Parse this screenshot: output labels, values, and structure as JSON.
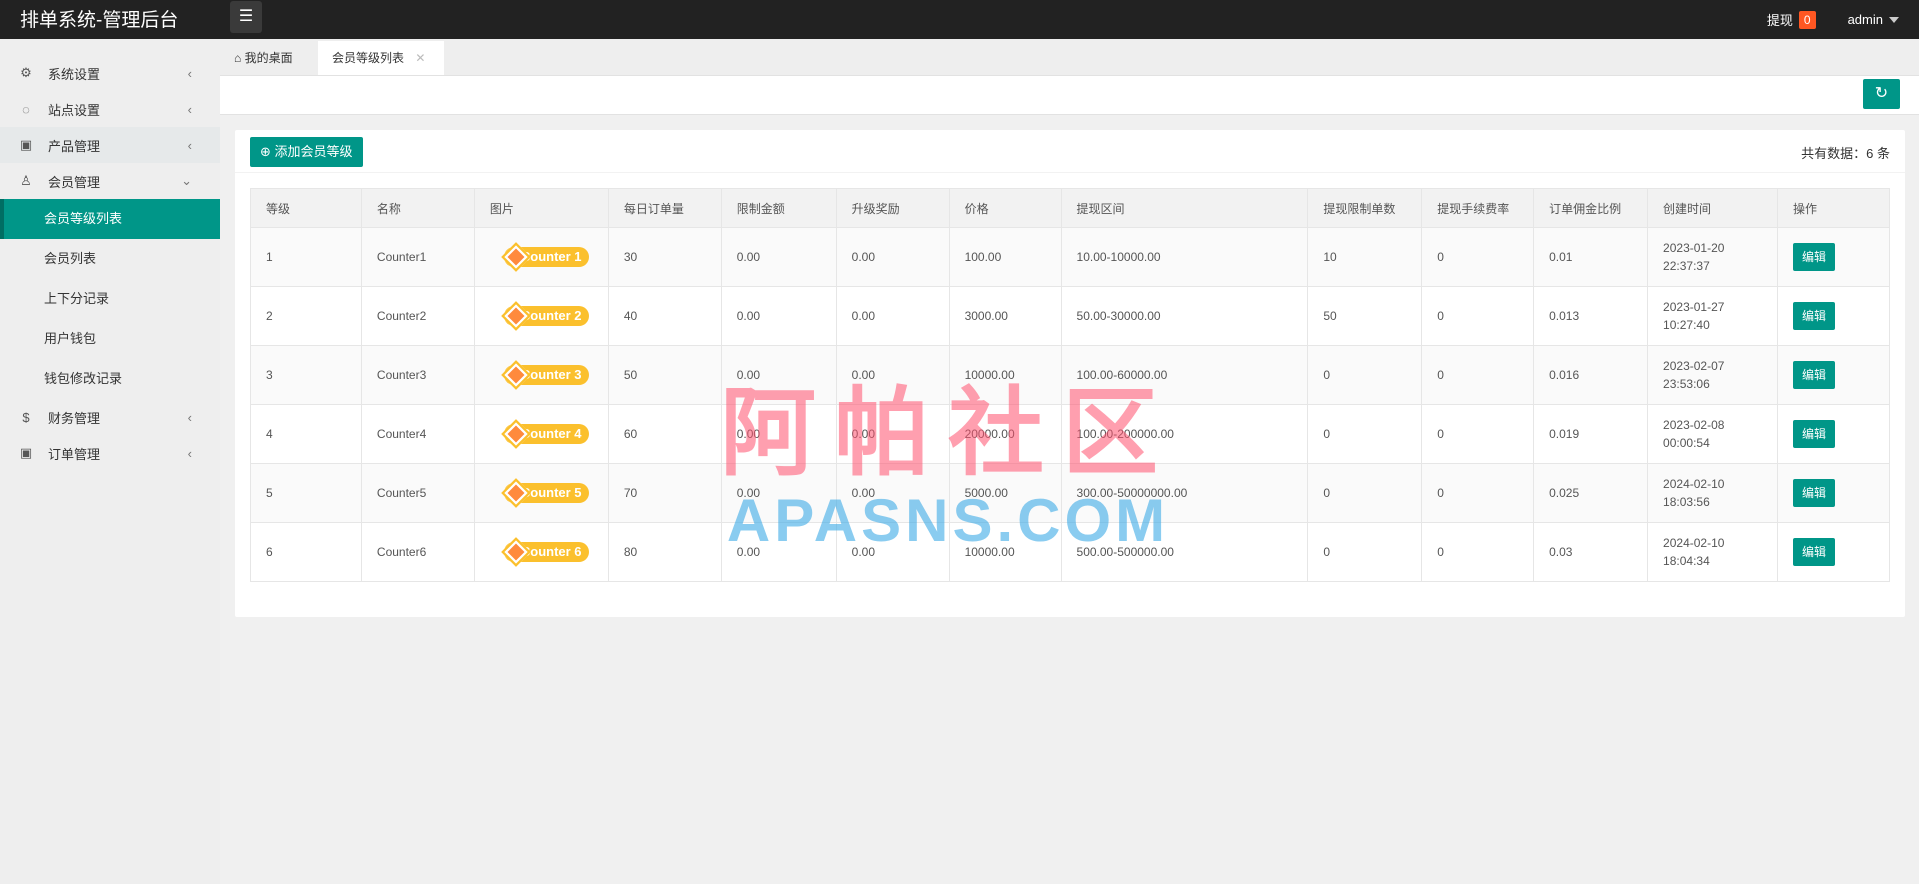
{
  "header": {
    "title": "排单系统-管理后台",
    "withdraw_label": "提现",
    "withdraw_count": "0",
    "user": "admin"
  },
  "sidebar": {
    "items": [
      {
        "label": "系统设置",
        "icon": "gear-icon"
      },
      {
        "label": "站点设置",
        "icon": "site-icon"
      },
      {
        "label": "产品管理",
        "icon": "box-icon"
      },
      {
        "label": "会员管理",
        "icon": "user-icon"
      },
      {
        "label": "财务管理",
        "icon": "dollar-icon"
      },
      {
        "label": "订单管理",
        "icon": "box-icon"
      }
    ],
    "sub_items": [
      "会员等级列表",
      "会员列表",
      "上下分记录",
      "用户钱包",
      "钱包修改记录"
    ]
  },
  "tabs": {
    "home": "我的桌面",
    "current": "会员等级列表"
  },
  "card": {
    "add_label": "添加会员等级",
    "total": "共有数据：6 条"
  },
  "table": {
    "headers": [
      "等级",
      "名称",
      "图片",
      "每日订单量",
      "限制金额",
      "升级奖励",
      "价格",
      "提现区间",
      "提现限制单数",
      "提现手续费率",
      "订单佣金比例",
      "创建时间",
      "操作"
    ],
    "rows": [
      [
        "1",
        "Counter1",
        "Counter 1",
        "30",
        "0.00",
        "0.00",
        "100.00",
        "10.00-10000.00",
        "10",
        "0",
        "0.01",
        "2023-01-20 22:37:37",
        "编辑"
      ],
      [
        "2",
        "Counter2",
        "Counter 2",
        "40",
        "0.00",
        "0.00",
        "3000.00",
        "50.00-30000.00",
        "50",
        "0",
        "0.013",
        "2023-01-27 10:27:40",
        "编辑"
      ],
      [
        "3",
        "Counter3",
        "Counter 3",
        "50",
        "0.00",
        "0.00",
        "10000.00",
        "100.00-60000.00",
        "0",
        "0",
        "0.016",
        "2023-02-07 23:53:06",
        "编辑"
      ],
      [
        "4",
        "Counter4",
        "Counter 4",
        "60",
        "0.00",
        "0.00",
        "20000.00",
        "100.00-200000.00",
        "0",
        "0",
        "0.019",
        "2023-02-08 00:00:54",
        "编辑"
      ],
      [
        "5",
        "Counter5",
        "Counter 5",
        "70",
        "0.00",
        "0.00",
        "5000.00",
        "300.00-50000000.00",
        "0",
        "0",
        "0.025",
        "2024-02-10 18:03:56",
        "编辑"
      ],
      [
        "6",
        "Counter6",
        "Counter 6",
        "80",
        "0.00",
        "0.00",
        "10000.00",
        "500.00-500000.00",
        "0",
        "0",
        "0.03",
        "2024-02-10 18:04:34",
        "编辑"
      ]
    ]
  },
  "watermark": {
    "line1": "阿帕社区",
    "line2": "APASNS.COM"
  }
}
